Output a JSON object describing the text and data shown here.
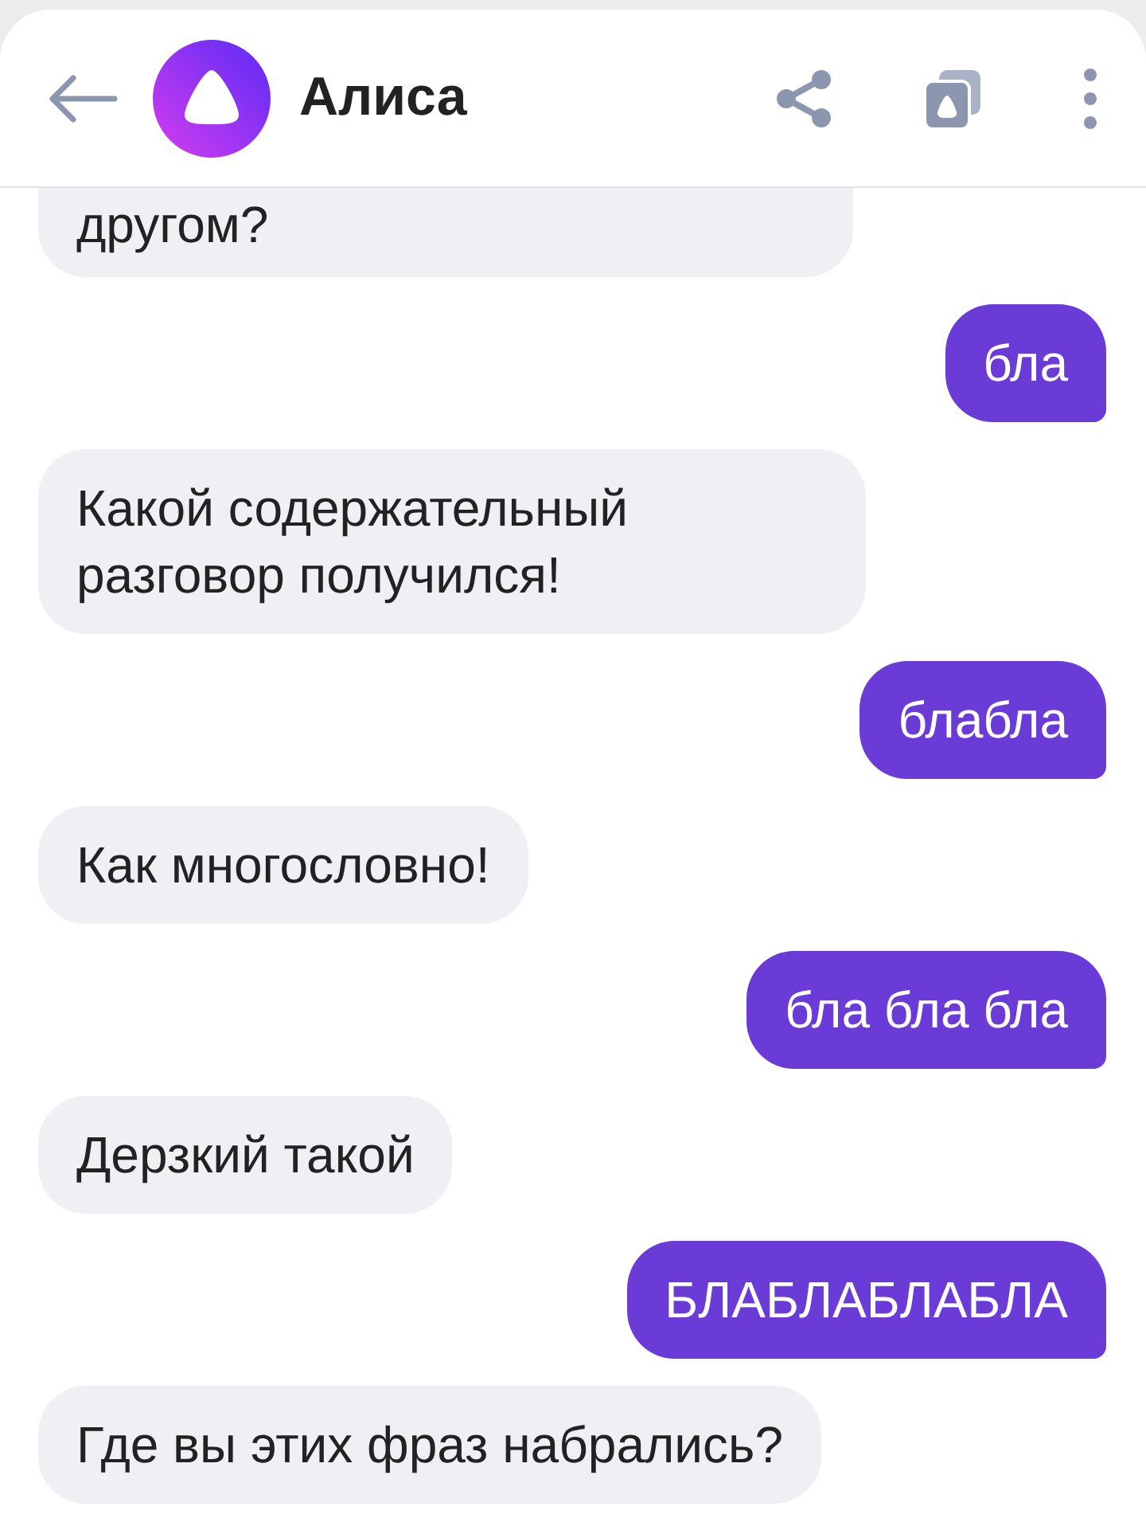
{
  "header": {
    "title": "Алиса"
  },
  "messages": [
    {
      "kind": "incoming-cut",
      "text": "другом?"
    },
    {
      "kind": "outgoing",
      "text": "бла"
    },
    {
      "kind": "incoming",
      "text": "Какой содержательный разговор получился!"
    },
    {
      "kind": "outgoing",
      "text": "блабла"
    },
    {
      "kind": "incoming",
      "text": "Как многословно!"
    },
    {
      "kind": "outgoing",
      "text": "бла бла бла"
    },
    {
      "kind": "incoming",
      "text": "Дерзкий такой"
    },
    {
      "kind": "outgoing",
      "text": "БЛАБЛАБЛАБЛА"
    },
    {
      "kind": "incoming",
      "text": "Где вы этих фраз набрались?"
    }
  ]
}
